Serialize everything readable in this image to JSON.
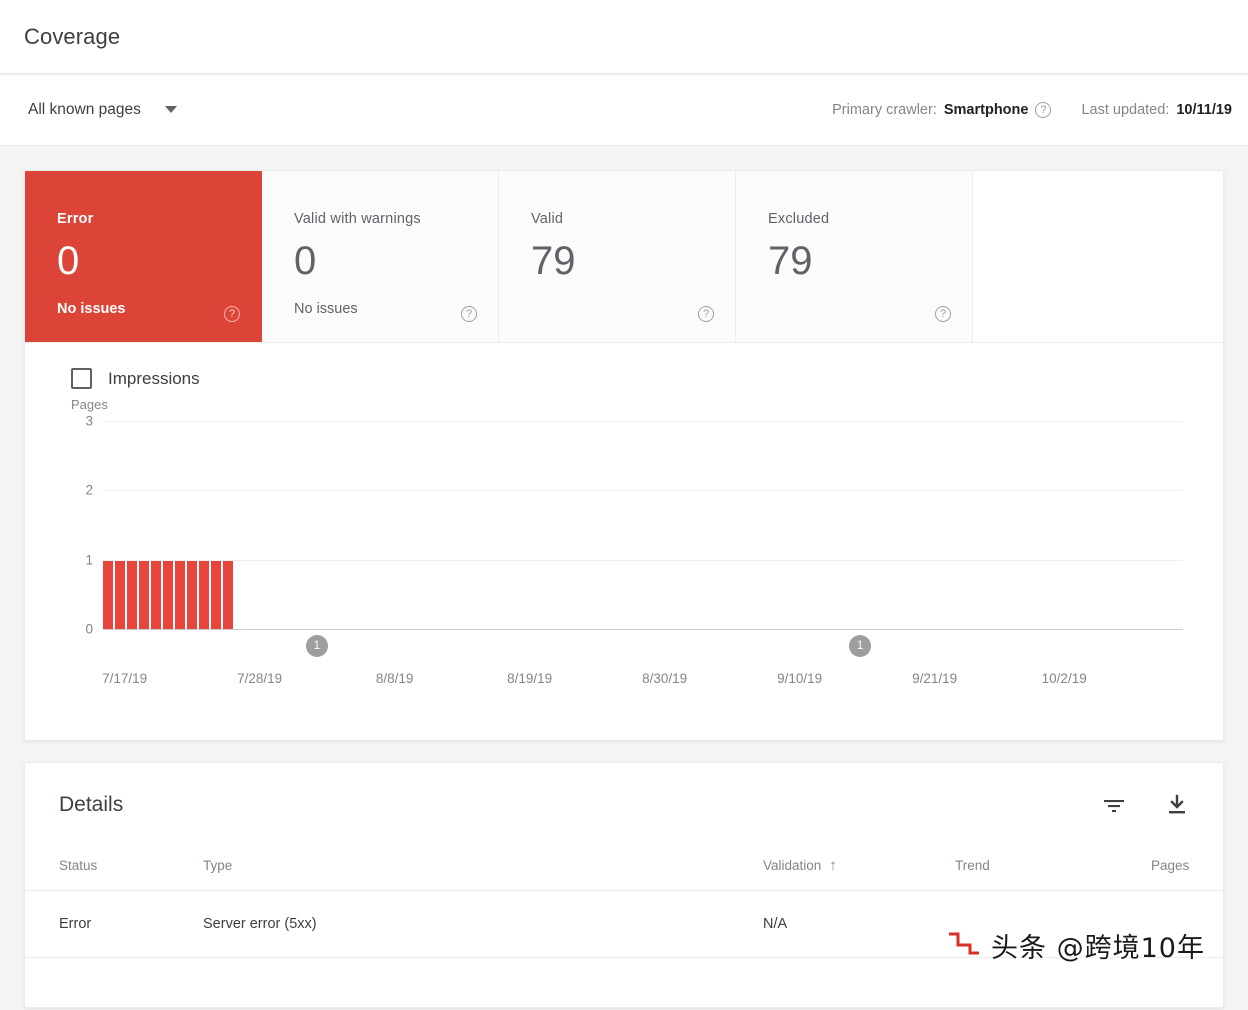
{
  "header": {
    "title": "Coverage"
  },
  "toolbar": {
    "scope_label": "All known pages",
    "caret_icon": "chevron-down-icon",
    "primary_crawler_label": "Primary crawler:",
    "primary_crawler_value": "Smartphone",
    "last_updated_label": "Last updated:",
    "last_updated_value": "10/11/19",
    "help_icon": "help-circle-icon"
  },
  "status_cards": [
    {
      "name": "Error",
      "value": "0",
      "sub": "No issues",
      "selected": true,
      "color": "#dc4437"
    },
    {
      "name": "Valid with warnings",
      "value": "0",
      "sub": "No issues",
      "selected": false
    },
    {
      "name": "Valid",
      "value": "79",
      "sub": "",
      "selected": false
    },
    {
      "name": "Excluded",
      "value": "79",
      "sub": "",
      "selected": false
    }
  ],
  "chart_legend": {
    "impressions_label": "Impressions",
    "impressions_checked": false
  },
  "chart_data": {
    "type": "bar",
    "title": "",
    "ylabel": "Pages",
    "xlabel": "",
    "ylim": [
      0,
      3
    ],
    "yticks": [
      0,
      1,
      2,
      3
    ],
    "grid": true,
    "bar_color": "#e8453c",
    "categories": [
      "7/17/19",
      "7/18/19",
      "7/19/19",
      "7/20/19",
      "7/21/19",
      "7/22/19",
      "7/23/19",
      "7/24/19",
      "7/25/19",
      "7/26/19",
      "7/27/19"
    ],
    "values": [
      1,
      1,
      1,
      1,
      1,
      1,
      1,
      1,
      1,
      1,
      1
    ],
    "series": [
      {
        "name": "Error",
        "values": [
          1,
          1,
          1,
          1,
          1,
          1,
          1,
          1,
          1,
          1,
          1
        ]
      }
    ],
    "xtick_labels": [
      "7/17/19",
      "7/28/19",
      "8/8/19",
      "8/19/19",
      "8/30/19",
      "9/10/19",
      "9/21/19",
      "10/2/19"
    ],
    "xtick_positions_pct": [
      2.0,
      14.5,
      27.0,
      39.5,
      52.0,
      64.5,
      77.0,
      89.0
    ],
    "annotations": [
      {
        "label": "1",
        "position_pct": 19.8
      },
      {
        "label": "1",
        "position_pct": 70.1
      }
    ]
  },
  "details": {
    "title": "Details",
    "filter_icon": "filter-icon",
    "download_icon": "download-icon",
    "columns": [
      {
        "key": "status",
        "label": "Status",
        "sorted": false
      },
      {
        "key": "type",
        "label": "Type",
        "sorted": false
      },
      {
        "key": "validation",
        "label": "Validation",
        "sorted": true,
        "sort_arrow": "↑"
      },
      {
        "key": "trend",
        "label": "Trend",
        "sorted": false
      },
      {
        "key": "pages",
        "label": "Pages",
        "sorted": false
      }
    ],
    "rows": [
      {
        "status": "Error",
        "type": "Server error (5xx)",
        "validation": "N/A",
        "trend": "",
        "pages": ""
      }
    ]
  },
  "watermark": {
    "text": "头条 @跨境10年",
    "mark_color": "#d93025"
  }
}
